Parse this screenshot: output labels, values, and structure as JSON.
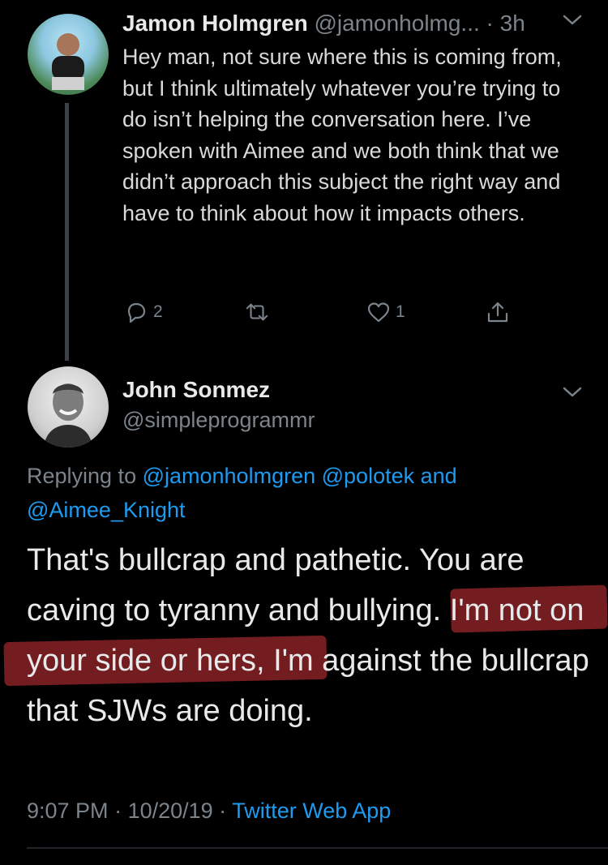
{
  "reply_tweet": {
    "author_name": "Jamon Holmgren",
    "author_handle": "@jamonholmg...",
    "separator": " · ",
    "time_ago": "3h",
    "text": "Hey man, not sure where this is coming from, but I think ultimately whatever you’re trying to do isn’t helping the conversation here. I’ve spoken with Aimee and we both think that we didn’t approach this subject the right way and have to think about how it impacts others.",
    "reply_count": "2",
    "retweet_count": "",
    "like_count": "1",
    "icons": [
      "reply-icon",
      "retweet-icon",
      "like-icon",
      "share-icon",
      "chevron-down-icon"
    ]
  },
  "main_tweet": {
    "author_name": "John Sonmez",
    "author_handle": "@simpleprogrammr",
    "replying_prefix": "Replying to ",
    "replying_to_1": "@jamonholmgren",
    "replying_to_2": "@polotek",
    "replying_and": " and",
    "replying_to_3": "@Aimee_Knight",
    "text": "That's bullcrap and pathetic. You are caving to tyranny and bullying. I'm not on your side or hers, I'm against the bullcrap that SJWs are doing.",
    "time": "9:07 PM",
    "date": "10/20/19",
    "dot": " · ",
    "source": "Twitter Web App"
  },
  "colors": {
    "background": "#000000",
    "link": "#1d9bf0",
    "muted": "#7b838b",
    "highlight": "#7a1f22"
  }
}
